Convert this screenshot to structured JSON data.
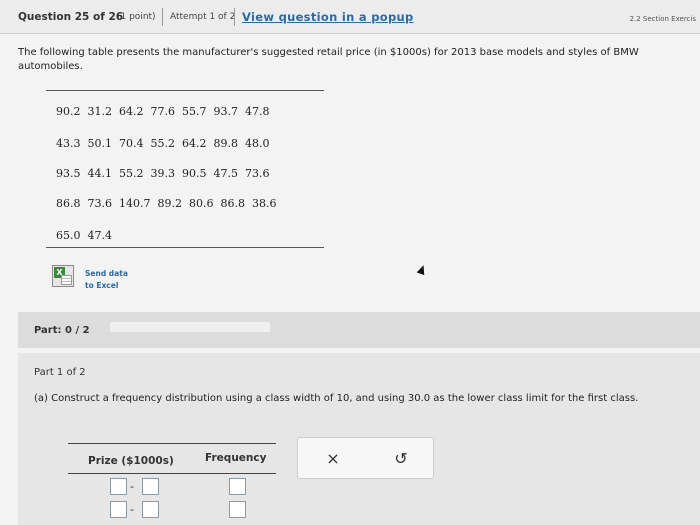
{
  "header": {
    "question_number": "Question 25 of 26",
    "points": "(1 point)",
    "attempt": "Attempt 1 of 2",
    "popup_link": "View question in a popup",
    "section": "2.2 Section Exercis"
  },
  "prompt": "The following table presents the manufacturer's suggested retail price (in $1000s) for 2013 base models and styles of BMW automobiles.",
  "data_table": {
    "rows": [
      [
        "90.2",
        "31.2",
        "64.2",
        "77.6",
        "55.7",
        "93.7",
        "47.8"
      ],
      [
        "43.3",
        "50.1",
        "70.4",
        "55.2",
        "64.2",
        "89.8",
        "48.0"
      ],
      [
        "93.5",
        "44.1",
        "55.2",
        "39.3",
        "90.5",
        "47.5",
        "73.6"
      ],
      [
        "86.8",
        "73.6",
        "140.7",
        "89.2",
        "80.6",
        "86.8",
        "38.6"
      ],
      [
        "65.0",
        "47.4"
      ]
    ]
  },
  "excel": {
    "line1": "Send data",
    "line2": "to Excel"
  },
  "part": {
    "label": "Part: 0 / 2",
    "progress_fraction": 0.0
  },
  "part1": {
    "label": "Part 1 of 2",
    "question": "(a) Construct a frequency distribution using a class width of 10, and using 30.0 as the lower class limit for the first class."
  },
  "freq_table": {
    "col1": "Prize ($1000s)",
    "col2": "Frequency",
    "dash": "-"
  },
  "toolbox": {
    "clear": "×",
    "undo": "↺"
  },
  "colors": {
    "link": "#2a6aa8",
    "progress": "#4a90d9"
  }
}
